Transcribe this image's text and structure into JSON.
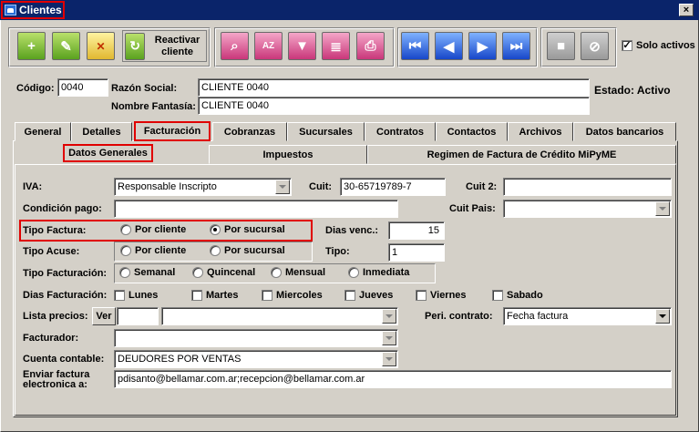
{
  "window": {
    "title": "Clientes",
    "close_icon": "close-icon"
  },
  "toolbar": {
    "reactivar_label": "Reactivar cliente",
    "solo_activos_label": "Solo activos",
    "solo_activos_checked": true
  },
  "header": {
    "codigo_label": "Código:",
    "codigo_value": "0040",
    "razon_label": "Razón Social:",
    "razon_value": "CLIENTE 0040",
    "fantasia_label": "Nombre Fantasía:",
    "fantasia_value": "CLIENTE 0040",
    "estado_label": "Estado: Activo"
  },
  "tabs": [
    "General",
    "Detalles",
    "Facturación",
    "Cobranzas",
    "Sucursales",
    "Contratos",
    "Contactos",
    "Archivos",
    "Datos bancarios"
  ],
  "subtabs": [
    "Datos Generales",
    "Impuestos",
    "Regimen de Factura de Crédito MiPyME"
  ],
  "form": {
    "iva_label": "IVA:",
    "iva_value": "Responsable Inscripto",
    "cuit_label": "Cuit:",
    "cuit_value": "30-65719789-7",
    "cuit2_label": "Cuit 2:",
    "cuit2_value": "",
    "condicion_label": "Condición pago:",
    "condicion_value": "",
    "cuitpais_label": "Cuit Pais:",
    "cuitpais_value": "",
    "tipo_factura_label": "Tipo Factura:",
    "tf_opt1": "Por cliente",
    "tf_opt2": "Por sucursal",
    "dias_venc_label": "Dias venc.:",
    "dias_venc_value": "15",
    "tipo_acuse_label": "Tipo Acuse:",
    "ta_opt1": "Por cliente",
    "ta_opt2": "Por sucursal",
    "tipo_label": "Tipo:",
    "tipo_value": "1",
    "tipo_fact_label": "Tipo Facturación:",
    "tfact_opts": [
      "Semanal",
      "Quincenal",
      "Mensual",
      "Inmediata"
    ],
    "dias_fact_label": "Dias Facturación:",
    "dias": [
      "Lunes",
      "Martes",
      "Miercoles",
      "Jueves",
      "Viernes",
      "Sabado"
    ],
    "lista_label": "Lista precios:",
    "ver_label": "Ver",
    "lista_code": "",
    "lista_value": "",
    "peri_label": "Peri. contrato:",
    "peri_value": "Fecha factura",
    "facturador_label": "Facturador:",
    "facturador_value": "",
    "cuenta_label": "Cuenta contable:",
    "cuenta_value": "DEUDORES POR VENTAS",
    "enviar_label_1": "Enviar factura",
    "enviar_label_2": "electronica a:",
    "enviar_value": "pdisanto@bellamar.com.ar;recepcion@bellamar.com.ar"
  }
}
